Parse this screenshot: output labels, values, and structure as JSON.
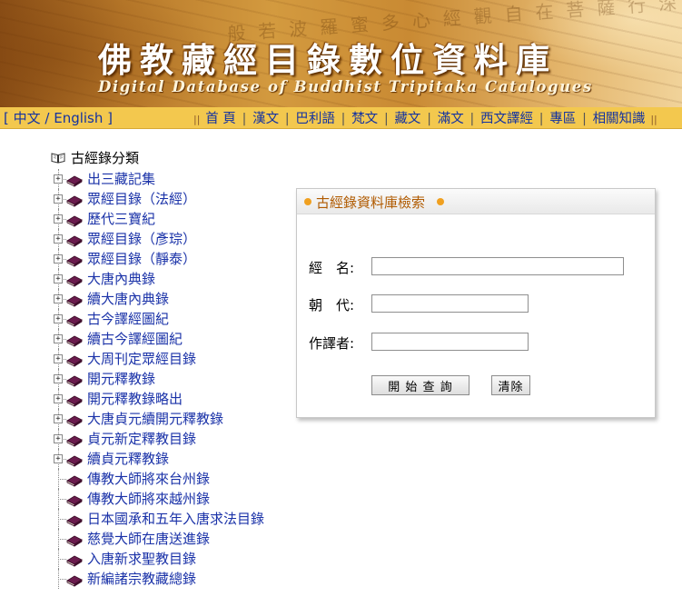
{
  "banner": {
    "title_zh": "佛教藏經目錄數位資料庫",
    "title_en": "Digital Database of Buddhist Tripitaka Catalogues",
    "bg_script": "般若波羅蜜多心經觀自在菩薩行深般若"
  },
  "nav": {
    "lang_label": "[ 中文 / English ]",
    "separator_glyph": "||",
    "pipe": "|",
    "links": [
      "首 頁",
      "漢文",
      "巴利語",
      "梵文",
      "藏文",
      "滿文",
      "西文譯經",
      "專區",
      "相關知識"
    ]
  },
  "tree": {
    "root_label": "古經錄分類",
    "expandable_symbol": "+",
    "items": [
      {
        "label": "出三藏記集",
        "expandable": true
      },
      {
        "label": "眾經目錄（法經）",
        "expandable": true
      },
      {
        "label": "歷代三寶紀",
        "expandable": true
      },
      {
        "label": "眾經目錄（彥琮）",
        "expandable": true
      },
      {
        "label": "眾經目錄（靜泰）",
        "expandable": true
      },
      {
        "label": "大唐內典錄",
        "expandable": true
      },
      {
        "label": "續大唐內典錄",
        "expandable": true
      },
      {
        "label": "古今譯經圖紀",
        "expandable": true
      },
      {
        "label": "續古今譯經圖紀",
        "expandable": true
      },
      {
        "label": "大周刊定眾經目錄",
        "expandable": true
      },
      {
        "label": "開元釋教錄",
        "expandable": true
      },
      {
        "label": "開元釋教錄略出",
        "expandable": true
      },
      {
        "label": "大唐貞元續開元釋教錄",
        "expandable": true
      },
      {
        "label": "貞元新定釋教目錄",
        "expandable": true
      },
      {
        "label": "續貞元釋教錄",
        "expandable": true
      },
      {
        "label": "傳教大師將來台州錄",
        "expandable": false
      },
      {
        "label": "傳教大師將來越州錄",
        "expandable": false
      },
      {
        "label": "日本國承和五年入唐求法目錄",
        "expandable": false
      },
      {
        "label": "慈覺大師在唐送進錄",
        "expandable": false
      },
      {
        "label": "入唐新求聖教目錄",
        "expandable": false
      },
      {
        "label": "新編諸宗教藏總錄",
        "expandable": false
      }
    ]
  },
  "search": {
    "title": "古經錄資料庫檢索",
    "fields": [
      {
        "label": "經　名:",
        "value": ""
      },
      {
        "label": "朝　代:",
        "value": ""
      },
      {
        "label": "作譯者:",
        "value": ""
      }
    ],
    "submit_label": "開 始 查 詢",
    "clear_label": "清除"
  },
  "colors": {
    "nav_bg": "#f3c84e",
    "link": "#1a32a8",
    "panel_title": "#b05a00",
    "book_icon": "#6a1b4d"
  }
}
